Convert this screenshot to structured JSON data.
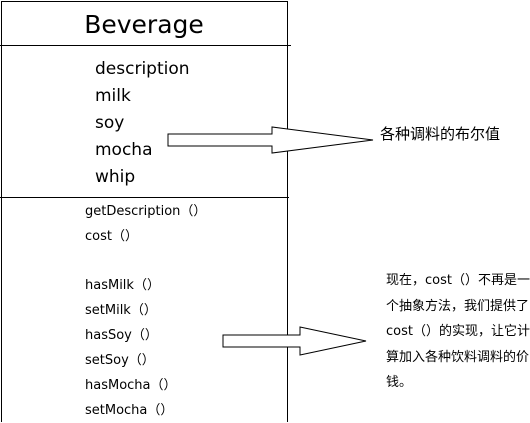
{
  "class": {
    "name": "Beverage",
    "attributes": [
      "description",
      "milk",
      "soy",
      "mocha",
      "whip"
    ],
    "methods": [
      "getDescription（）",
      "cost（）",
      "",
      "hasMilk（）",
      "setMilk（）",
      "hasSoy（）",
      "setSoy（）",
      "hasMocha（）",
      "setMocha（）"
    ]
  },
  "notes": {
    "booleans": "各种调料的布尔值",
    "cost_lines": [
      "现在，cost（）不再是一",
      "个抽象方法，我们提供了",
      "cost（）的实现，让它计",
      "算加入各种饮料调料的价",
      "钱。"
    ]
  }
}
